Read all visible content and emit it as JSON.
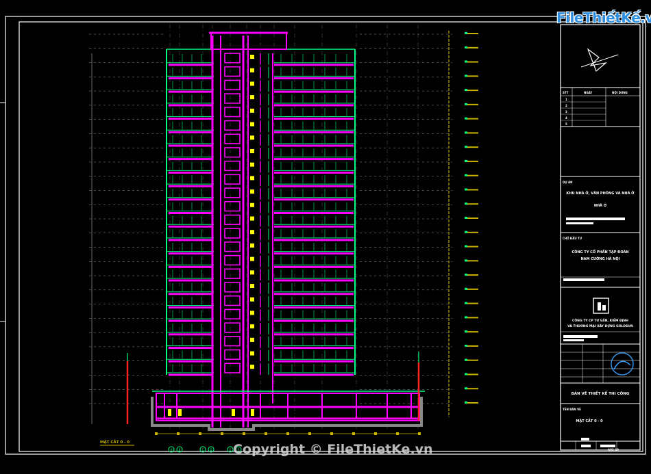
{
  "watermark": {
    "logo_text": "FileThiếtKế.vn",
    "copyright": "Copyright © FileThietKe.vn"
  },
  "drawing": {
    "section_label": "MẶT CẮT 0 - 0",
    "floor_count": 24,
    "grid_bubbles": [
      "A",
      "B",
      "C",
      "D",
      "E",
      "F"
    ]
  },
  "title_block": {
    "revision_headers": [
      "STT",
      "NGÀY",
      "NỘI DUNG"
    ],
    "revision_rows": [
      "1",
      "2",
      "3",
      "4",
      "5"
    ],
    "project_label": "DỰ ÁN",
    "project_name": "KHU NHÀ Ở, VĂN PHÒNG VÀ NHÀ Ở",
    "project_sub": "NHÀ Ở",
    "owner_label": "CHỦ ĐẦU TƯ",
    "owner_name_1": "CÔNG TY CỔ PHẦN TẬP ĐOÀN",
    "owner_name_2": "NAM CƯỜNG HÀ NỘI",
    "designer_name_1": "CÔNG TY CP TƯ VẤN, KIỂM ĐỊNH",
    "designer_name_2": "VÀ THƯƠNG MẠI XÂY DỰNG GOLDSUN",
    "phase": "BẢN VẼ THIẾT KẾ THI CÔNG",
    "sheet_label": "TÊN BẢN VẼ",
    "sheet_title": "MẶT CẮT 0 - 0",
    "sheet_number": "A02-10"
  },
  "colors": {
    "frame": "#ffffff",
    "wall": "#ff00ff",
    "slab": "#00ff7f",
    "level": "#c8b400",
    "grid": "#bbbbbb",
    "accent": "#ffff00",
    "red": "#ff2020"
  }
}
